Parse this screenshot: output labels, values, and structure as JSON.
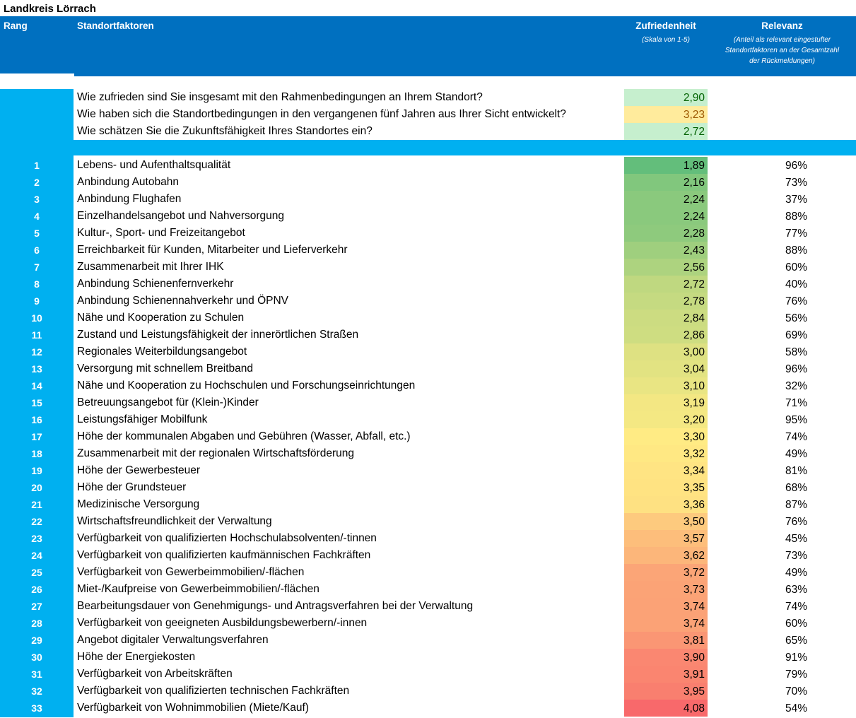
{
  "title": "Landkreis Lörrach",
  "header": {
    "rang": "Rang",
    "factors": "Standortfaktoren",
    "satisfaction": "Zufriedenheit",
    "satisfaction_sub": "(Skala von 1-5)",
    "relevance": "Relevanz",
    "relevance_sub_1": "(Anteil als relevant eingestufter",
    "relevance_sub_2": "Standortfaktoren an der Gesamtzahl",
    "relevance_sub_3": "der Rückmeldungen)"
  },
  "summary": [
    {
      "question": "Wie zufrieden sind Sie insgesamt mit den Rahmenbedingungen an Ihrem Standort?",
      "score": "2,90",
      "bg": "#c6efce",
      "fg": "#006100"
    },
    {
      "question": "Wie haben sich die Standortbedingungen in den vergangenen fünf Jahren aus Ihrer Sicht entwickelt?",
      "score": "3,23",
      "bg": "#ffeb9c",
      "fg": "#9c5700"
    },
    {
      "question": "Wie schätzen Sie die Zukunftsfähigkeit Ihres Standortes ein?",
      "score": "2,72",
      "bg": "#c6efce",
      "fg": "#006100"
    }
  ],
  "rows": [
    {
      "rank": "1",
      "factor": "Lebens- und Aufenthaltsqualität",
      "score": "1,89",
      "relevance": "96%"
    },
    {
      "rank": "2",
      "factor": "Anbindung Autobahn",
      "score": "2,16",
      "relevance": "73%"
    },
    {
      "rank": "3",
      "factor": "Anbindung Flughafen",
      "score": "2,24",
      "relevance": "37%"
    },
    {
      "rank": "4",
      "factor": "Einzelhandelsangebot und Nahversorgung",
      "score": "2,24",
      "relevance": "88%"
    },
    {
      "rank": "5",
      "factor": "Kultur-, Sport- und Freizeitangebot",
      "score": "2,28",
      "relevance": "77%"
    },
    {
      "rank": "6",
      "factor": "Erreichbarkeit für Kunden, Mitarbeiter und Lieferverkehr",
      "score": "2,43",
      "relevance": "88%"
    },
    {
      "rank": "7",
      "factor": "Zusammenarbeit mit Ihrer IHK",
      "score": "2,56",
      "relevance": "60%"
    },
    {
      "rank": "8",
      "factor": "Anbindung Schienenfernverkehr",
      "score": "2,72",
      "relevance": "40%"
    },
    {
      "rank": "9",
      "factor": "Anbindung Schienennahverkehr und ÖPNV",
      "score": "2,78",
      "relevance": "76%"
    },
    {
      "rank": "10",
      "factor": "Nähe und Kooperation zu Schulen",
      "score": "2,84",
      "relevance": "56%"
    },
    {
      "rank": "11",
      "factor": "Zustand und Leistungsfähigkeit der innerörtlichen Straßen",
      "score": "2,86",
      "relevance": "69%"
    },
    {
      "rank": "12",
      "factor": "Regionales Weiterbildungsangebot",
      "score": "3,00",
      "relevance": "58%"
    },
    {
      "rank": "13",
      "factor": "Versorgung mit schnellem Breitband",
      "score": "3,04",
      "relevance": "96%"
    },
    {
      "rank": "14",
      "factor": "Nähe und Kooperation zu Hochschulen und Forschungseinrichtungen",
      "score": "3,10",
      "relevance": "32%"
    },
    {
      "rank": "15",
      "factor": "Betreuungsangebot für (Klein-)Kinder",
      "score": "3,19",
      "relevance": "71%"
    },
    {
      "rank": "16",
      "factor": "Leistungsfähiger Mobilfunk",
      "score": "3,20",
      "relevance": "95%"
    },
    {
      "rank": "17",
      "factor": "Höhe der kommunalen Abgaben und Gebühren (Wasser, Abfall, etc.)",
      "score": "3,30",
      "relevance": "74%"
    },
    {
      "rank": "18",
      "factor": "Zusammenarbeit mit der regionalen Wirtschaftsförderung",
      "score": "3,32",
      "relevance": "49%"
    },
    {
      "rank": "19",
      "factor": "Höhe der Gewerbesteuer",
      "score": "3,34",
      "relevance": "81%"
    },
    {
      "rank": "20",
      "factor": "Höhe der Grundsteuer",
      "score": "3,35",
      "relevance": "68%"
    },
    {
      "rank": "21",
      "factor": "Medizinische Versorgung",
      "score": "3,36",
      "relevance": "87%"
    },
    {
      "rank": "22",
      "factor": "Wirtschaftsfreundlichkeit der Verwaltung",
      "score": "3,50",
      "relevance": "76%"
    },
    {
      "rank": "23",
      "factor": "Verfügbarkeit von qualifizierten Hochschulabsolventen/-tinnen",
      "score": "3,57",
      "relevance": "45%"
    },
    {
      "rank": "24",
      "factor": "Verfügbarkeit von qualifizierten kaufmännischen Fachkräften",
      "score": "3,62",
      "relevance": "73%"
    },
    {
      "rank": "25",
      "factor": "Verfügbarkeit von Gewerbeimmobilien/-flächen",
      "score": "3,72",
      "relevance": "49%"
    },
    {
      "rank": "26",
      "factor": "Miet-/Kaufpreise von Gewerbeimmobilien/-flächen",
      "score": "3,73",
      "relevance": "63%"
    },
    {
      "rank": "27",
      "factor": "Bearbeitungsdauer von Genehmigungs- und Antragsverfahren bei der Verwaltung",
      "score": "3,74",
      "relevance": "74%"
    },
    {
      "rank": "28",
      "factor": "Verfügbarkeit von geeigneten Ausbildungsbewerbern/-innen",
      "score": "3,74",
      "relevance": "60%"
    },
    {
      "rank": "29",
      "factor": "Angebot digitaler Verwaltungsverfahren",
      "score": "3,81",
      "relevance": "65%"
    },
    {
      "rank": "30",
      "factor": "Höhe der Energiekosten",
      "score": "3,90",
      "relevance": "91%"
    },
    {
      "rank": "31",
      "factor": "Verfügbarkeit von Arbeitskräften",
      "score": "3,91",
      "relevance": "79%"
    },
    {
      "rank": "32",
      "factor": "Verfügbarkeit von qualifizierten technischen Fachkräften",
      "score": "3,95",
      "relevance": "70%"
    },
    {
      "rank": "33",
      "factor": "Verfügbarkeit von Wohnimmobilien (Miete/Kauf)",
      "score": "4,08",
      "relevance": "54%"
    }
  ]
}
